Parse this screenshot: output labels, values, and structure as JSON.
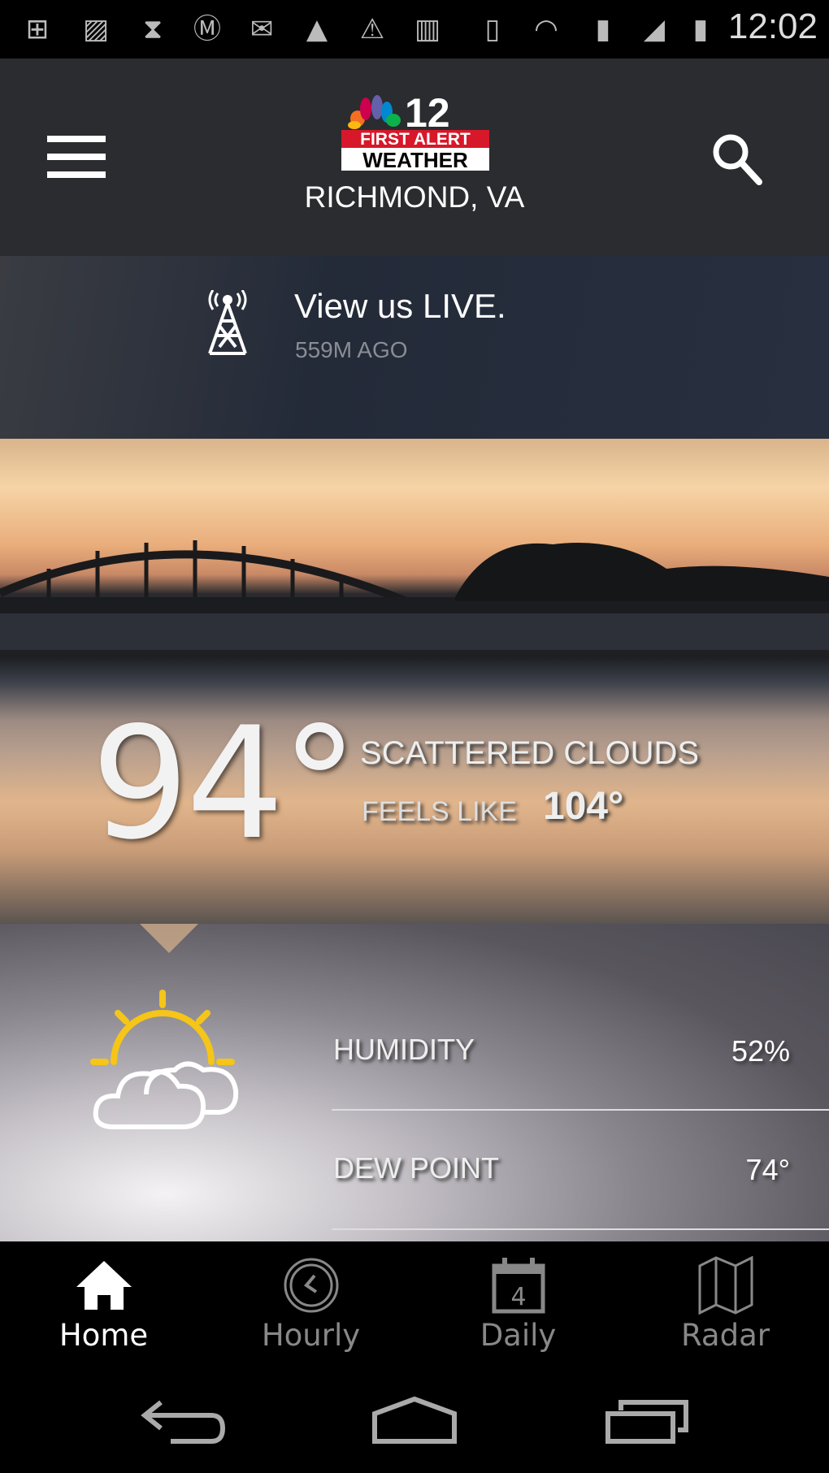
{
  "status_bar": {
    "time": "12:02",
    "icons": [
      "add-box-icon",
      "image-icon",
      "hourglass-icon",
      "motorola-icon",
      "gmail-icon",
      "triangle-app-icon",
      "warning-icon",
      "barcode-icon",
      "rotate-icon",
      "wifi-icon",
      "sd-card-icon",
      "signal-icon",
      "battery-charging-icon"
    ]
  },
  "header": {
    "logo_text": "12 FIRST ALERT WEATHER",
    "location": "RICHMOND, VA"
  },
  "live": {
    "title": "View us LIVE.",
    "time": "559M AGO"
  },
  "current": {
    "temperature": "94°",
    "condition": "SCATTERED CLOUDS",
    "feels_like_label": "FEELS LIKE",
    "feels_like_value": "104°"
  },
  "stats": [
    {
      "label": "HUMIDITY",
      "value": "52%"
    },
    {
      "label": "DEW POINT",
      "value": "74°"
    }
  ],
  "tabs": [
    {
      "label": "Home",
      "icon": "home-icon",
      "active": true
    },
    {
      "label": "Hourly",
      "icon": "clock-icon"
    },
    {
      "label": "Daily",
      "icon": "calendar-icon",
      "badge": "4"
    },
    {
      "label": "Radar",
      "icon": "map-icon"
    }
  ],
  "colors": {
    "accent_sun": "#f5c518",
    "header_bg": "#2b2c2f"
  }
}
